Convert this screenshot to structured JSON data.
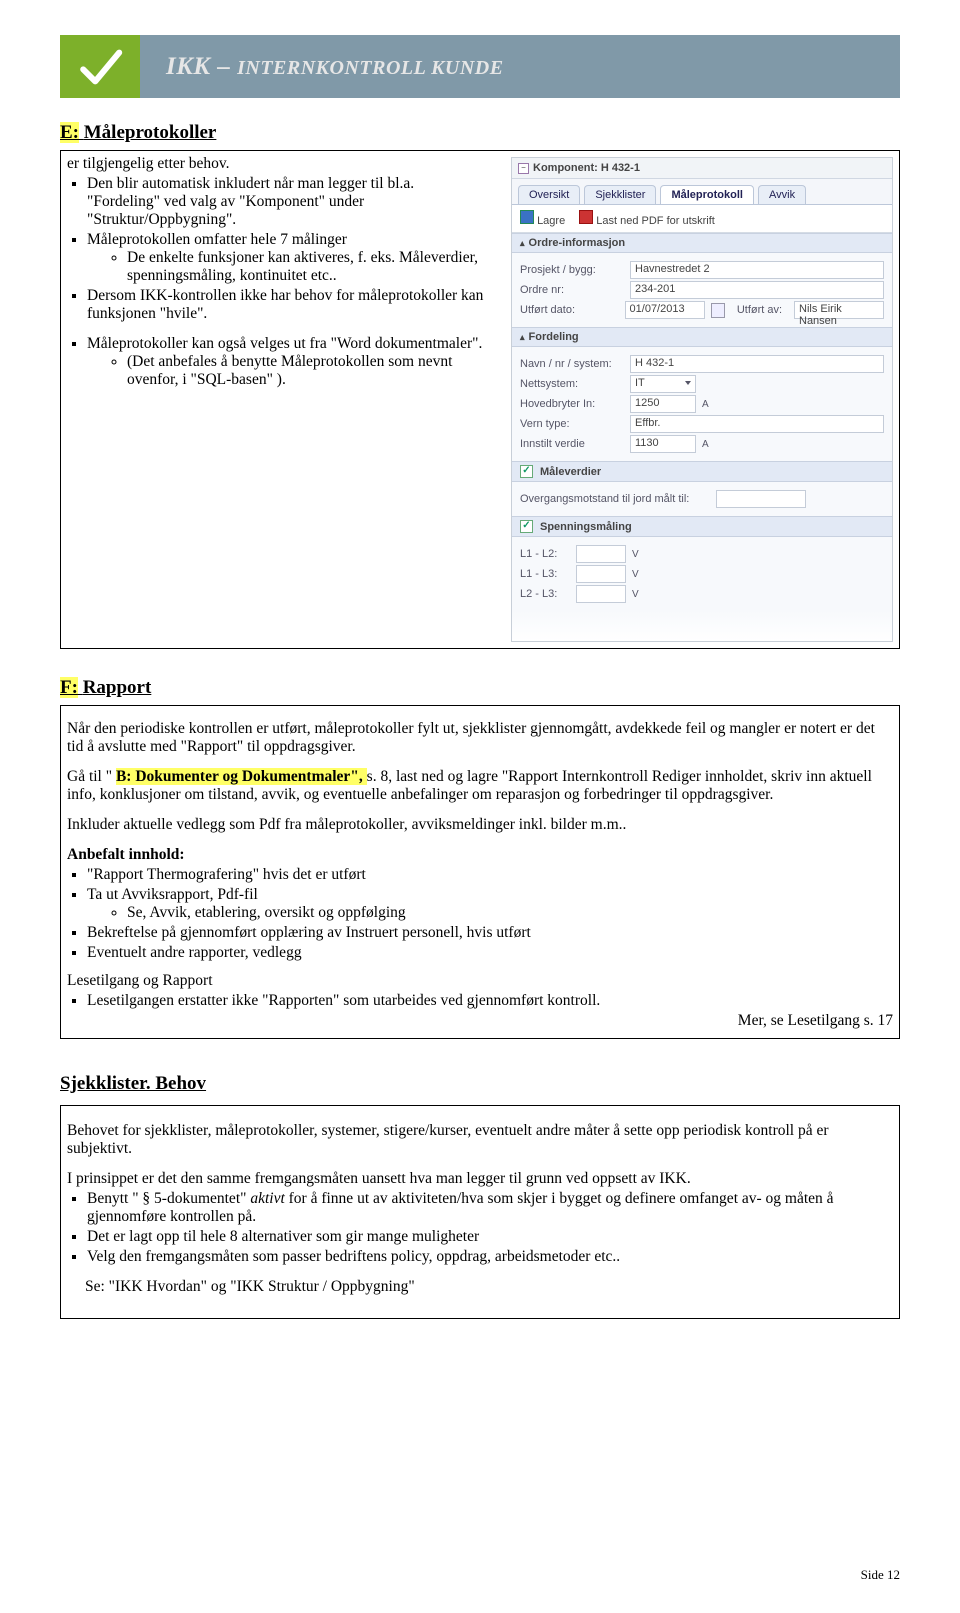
{
  "banner": {
    "title_prefix": "IKK – ",
    "title_rest": "internkontroll kunde"
  },
  "sectionE": {
    "heading_letter": "E:",
    "heading_text": "Måleprotokoller",
    "intro": "er tilgjengelig etter behov.",
    "bullets": [
      "Den blir automatisk inkludert når man legger til bl.a. \"Fordeling\" ved valg av \"Komponent\" under \"Struktur/Oppbygning\".",
      "Måleprotokollen omfatter hele 7 målinger",
      "Dersom IKK-kontrollen ikke har behov for måleprotokoller kan funksjonen \"hvile\"."
    ],
    "sub1": "De enkelte funksjoner kan aktiveres, f. eks. Måleverdier, spenningsmåling, kontinuitet etc..",
    "bullet4": "Måleprotokoller kan også velges ut fra \"Word dokumentmaler\".",
    "sub4": "(Det anbefales å benytte Måleprotokollen som nevnt ovenfor, i \"SQL-basen\" )."
  },
  "appPanel": {
    "component_label": "Komponent: H 432-1",
    "tabs": {
      "oversikt": "Oversikt",
      "sjekklister": "Sjekklister",
      "maleprotokoll": "Måleprotokoll",
      "avvik": "Avvik"
    },
    "toolbar": {
      "lagre": "Lagre",
      "pdf": "Last ned PDF for utskrift"
    },
    "section_ordre": "Ordre-informasjon",
    "rows_ordre": {
      "prosjekt_l": "Prosjekt / bygg:",
      "prosjekt_v": "Havnestredet 2",
      "ordre_l": "Ordre nr:",
      "ordre_v": "234-201",
      "utfort_l": "Utført dato:",
      "utfort_v": "01/07/2013",
      "utfort_av_l": "Utført av:",
      "utfort_av_v": "Nils Eirik  Nansen"
    },
    "section_fordeling": "Fordeling",
    "rows_ford": {
      "navn_l": "Navn / nr / system:",
      "navn_v": "H 432-1",
      "netts_l": "Nettsystem:",
      "netts_v": "IT",
      "hbryt_l": "Hovedbryter In:",
      "hbryt_v": "1250",
      "hbryt_u": "A",
      "vern_l": "Vern type:",
      "vern_v": "Effbr.",
      "inn_l": "Innstilt verdie",
      "inn_v": "1130",
      "inn_u": "A"
    },
    "section_male": "Måleverdier",
    "male_row_l": "Overgangsmotstand til jord målt til:",
    "section_spenn": "Spenningsmåling",
    "spenn": {
      "r1_l": "L1 - L2:",
      "r2_l": "L1 - L3:",
      "r3_l": "L2 - L3:",
      "unit": "V"
    }
  },
  "sectionF": {
    "heading_letter": "F:",
    "heading_text": "Rapport",
    "p1": "Når den periodiske kontrollen er utført, måleprotokoller fylt ut, sjekklister gjennomgått, avdekkede feil og mangler er notert er det tid å avslutte med \"Rapport\" til oppdragsgiver.",
    "p2_pre": "Gå til \" ",
    "p2_b": "B: Dokumenter og Dokumentmaler\", ",
    "p2_post": "s. 8, last ned og lagre \"Rapport Internkontroll Rediger innholdet, skriv inn aktuell info, konklusjoner om tilstand, avvik, og eventuelle anbefalinger om reparasjon og forbedringer til oppdragsgiver.",
    "p3": "Inkluder aktuelle vedlegg som Pdf fra måleprotokoller, avviksmeldinger inkl. bilder m.m..",
    "anbef_h": "Anbefalt innhold:",
    "anbef": {
      "b1": "\"Rapport Thermografering\" hvis det er utført",
      "b2": "Ta ut Avviksrapport, Pdf-fil",
      "b2s": "Se, Avvik, etablering, oversikt og oppfølging",
      "b3": "Bekreftelse på gjennomført opplæring av Instruert personell, hvis utført",
      "b4": "Eventuelt andre rapporter, vedlegg"
    },
    "lt_h": "Lesetilgang og Rapport",
    "lt_b": "Lesetilgangen erstatter ikke \"Rapporten\" som utarbeides ved gjennomført kontroll.",
    "lt_more": "Mer, se Lesetilgang s. 17"
  },
  "sjekk": {
    "heading": "Sjekklister. Behov",
    "p1": "Behovet for sjekklister, måleprotokoller, systemer, stigere/kurser, eventuelt andre måter å sette opp periodisk kontroll på er subjektivt.",
    "p2": "I prinsippet er det den samme fremgangsmåten uansett hva man legger til grunn ved oppsett av IKK.",
    "b1_pre": "Benytt \" § 5-dokumentet\" ",
    "b1_em": "aktivt",
    "b1_post": " for å finne ut av aktiviteten/hva som skjer i bygget og definere omfanget av- og måten å gjennomføre kontrollen på.",
    "b2": "Det er lagt opp til hele 8 alternativer som gir mange muligheter",
    "b3": "Velg den fremgangsmåten som passer bedriftens policy, oppdrag, arbeidsmetoder etc..",
    "se": "Se: \"IKK Hvordan\" og \"IKK Struktur / Oppbygning\""
  },
  "page_number": "Side 12"
}
